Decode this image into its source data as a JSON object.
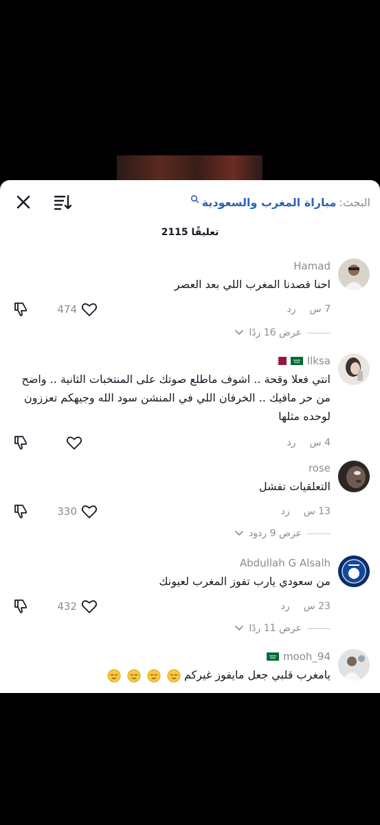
{
  "header": {
    "search_prefix": "البحث:",
    "search_query": "مباراة المغرب والسعودية"
  },
  "comment_count": "2115 تعليقًا",
  "comments": [
    {
      "username": "Hamad",
      "text": "احنا قصدنا المغرب اللي بعد العصر",
      "time": "7 س",
      "reply": "رد",
      "likes": "474",
      "view_replies": "عرض 16 ردًا"
    },
    {
      "username": "Ilksa",
      "text": "انتي فعلا وقحة .. اشوف ماطلع صوتك على المنتخبات الثانية .. واضح من حر مافيك .. الخرفان اللي في المنشن سود الله وجيهكم تعززون لوحده مثلها",
      "time": "4 س",
      "reply": "رد",
      "likes": ""
    },
    {
      "username": "rose",
      "text": "التعلقيات تفشل",
      "time": "13 س",
      "reply": "رد",
      "likes": "330",
      "view_replies": "عرض 9 ردود"
    },
    {
      "username": "Abdullah G Alsalh",
      "text": "من سعودي يارب تفوز المغرب لعيونك",
      "time": "23 س",
      "reply": "رد",
      "likes": "432",
      "view_replies": "عرض 11 ردًا"
    },
    {
      "username": "mooh_94",
      "text": "يامغرب قلبي جعل مايفوز غيركم"
    }
  ],
  "colors": {
    "link_blue": "#2f62b6",
    "muted_gray": "#8a8b91",
    "text_dark": "#161823",
    "flag_green": "#006c35",
    "flag_maroon": "#8d1b3d"
  }
}
